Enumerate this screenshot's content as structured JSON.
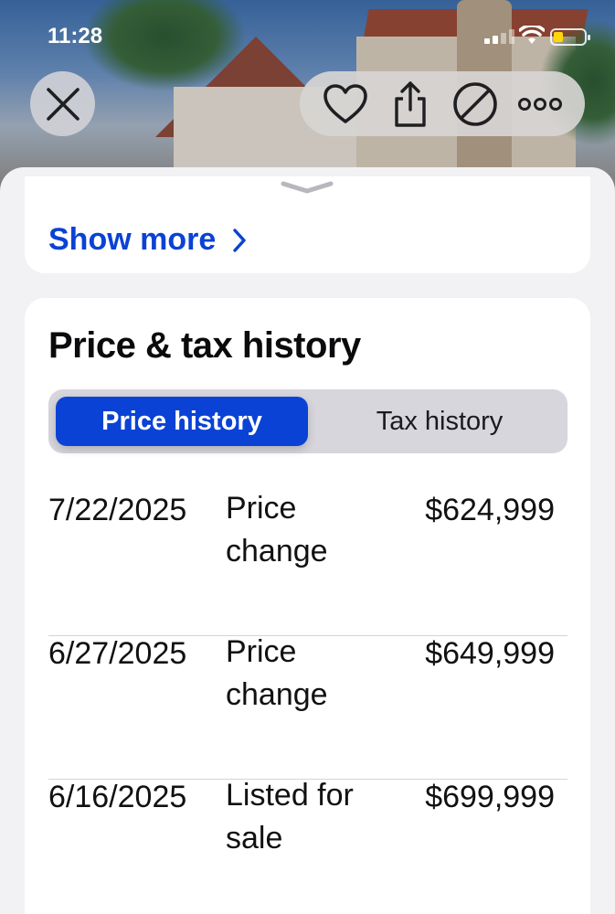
{
  "status_bar": {
    "time": "11:28"
  },
  "hero": {
    "description": ""
  },
  "show_more": {
    "label": "Show more"
  },
  "price_tax": {
    "title": "Price & tax history",
    "tabs": [
      {
        "label": "Price history",
        "active": true
      },
      {
        "label": "Tax history",
        "active": false
      }
    ],
    "rows": [
      {
        "date": "7/22/2025",
        "event": "Price change",
        "price": "$624,999"
      },
      {
        "date": "6/27/2025",
        "event": "Price change",
        "price": "$649,999"
      },
      {
        "date": "6/16/2025",
        "event": "Listed for sale",
        "price": "$699,999"
      }
    ]
  },
  "colors": {
    "accent": "#0a42d6",
    "background": "#f2f2f5",
    "card": "#ffffff"
  },
  "icons": [
    "close-icon",
    "heart-icon",
    "share-icon",
    "block-icon",
    "more-icon",
    "chevron-right-icon",
    "grabber-icon"
  ]
}
